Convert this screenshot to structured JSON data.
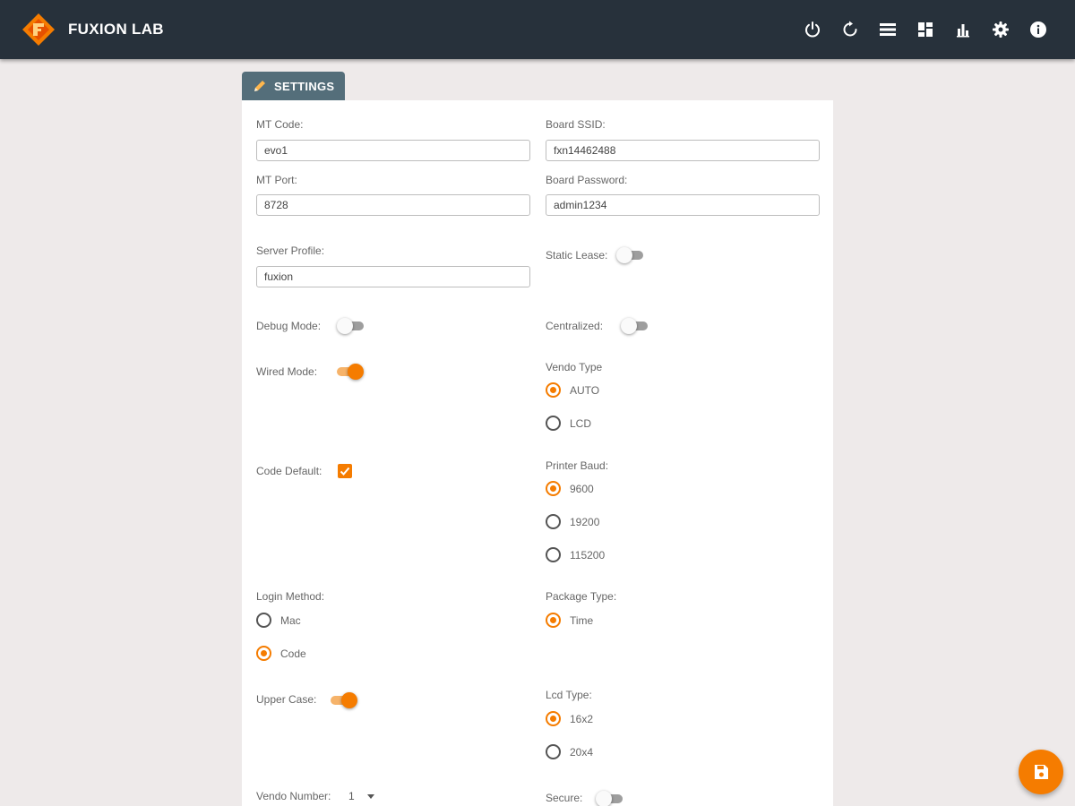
{
  "app": {
    "title": "FUXION LAB"
  },
  "colors": {
    "topbar": "#27313b",
    "accent": "#f57c00",
    "tab": "#546e7a",
    "background": "#eeeaea"
  },
  "toolbar_icons": [
    "power-icon",
    "restart-icon",
    "list-icon",
    "dashboard-icon",
    "bar-chart-icon",
    "gear-icon",
    "info-icon"
  ],
  "settings_tab": {
    "label": "SETTINGS",
    "icon": "pencil-icon"
  },
  "form": {
    "mt_code": {
      "label": "MT Code:",
      "value": "evo1"
    },
    "board_ssid": {
      "label": "Board SSID:",
      "value": "fxn14462488"
    },
    "mt_port": {
      "label": "MT Port:",
      "value": "8728"
    },
    "board_password": {
      "label": "Board Password:",
      "value": "admin1234"
    },
    "server_profile": {
      "label": "Server Profile:",
      "value": "fuxion"
    },
    "static_lease": {
      "label": "Static Lease:",
      "on": false
    },
    "debug_mode": {
      "label": "Debug Mode:",
      "on": false
    },
    "centralized": {
      "label": "Centralized:",
      "on": false
    },
    "wired_mode": {
      "label": "Wired Mode:",
      "on": true
    },
    "vendo_type": {
      "label": "Vendo Type",
      "options": [
        "AUTO",
        "LCD"
      ],
      "selected": "AUTO"
    },
    "code_default": {
      "label": "Code Default:",
      "checked": true
    },
    "printer_baud": {
      "label": "Printer Baud:",
      "options": [
        "9600",
        "19200",
        "115200"
      ],
      "selected": "9600"
    },
    "login_method": {
      "label": "Login Method:",
      "options": [
        "Mac",
        "Code"
      ],
      "selected": "Code"
    },
    "package_type": {
      "label": "Package Type:",
      "options": [
        "Time"
      ],
      "selected": "Time"
    },
    "upper_case": {
      "label": "Upper Case:",
      "on": true
    },
    "lcd_type": {
      "label": "Lcd Type:",
      "options": [
        "16x2",
        "20x4"
      ],
      "selected": "16x2"
    },
    "vendo_number": {
      "label": "Vendo Number:",
      "value": "1"
    },
    "secure": {
      "label": "Secure:",
      "on": false
    }
  },
  "fab": {
    "icon": "save-icon"
  }
}
